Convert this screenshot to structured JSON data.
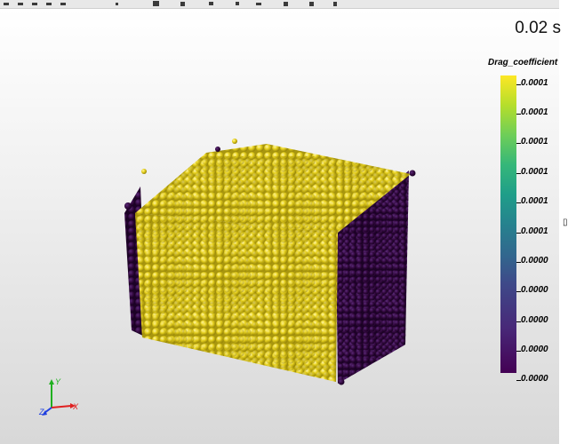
{
  "time_annotation": "0.02 s",
  "colorbar": {
    "title": "Drag_coefficient",
    "labels": [
      "0.0001",
      "0.0001",
      "0.0001",
      "0.0001",
      "0.0001",
      "0.0001",
      "0.0000",
      "0.0000",
      "0.0000",
      "0.0000",
      "0.0000"
    ]
  },
  "axes": {
    "x": "X",
    "y": "Y",
    "z": "Z"
  },
  "colors": {
    "high": "#fde725",
    "low": "#440154",
    "x_axis": "#e02020",
    "y_axis": "#20b020",
    "z_axis": "#2040e0"
  },
  "toolbar": {
    "icons": [
      "tool-icon",
      "tool-icon",
      "tool-icon",
      "tool-icon",
      "tool-icon",
      "tool-icon",
      "tool-icon",
      "tool-icon",
      "tool-icon",
      "tool-icon",
      "tool-icon",
      "tool-icon",
      "tool-icon"
    ]
  }
}
